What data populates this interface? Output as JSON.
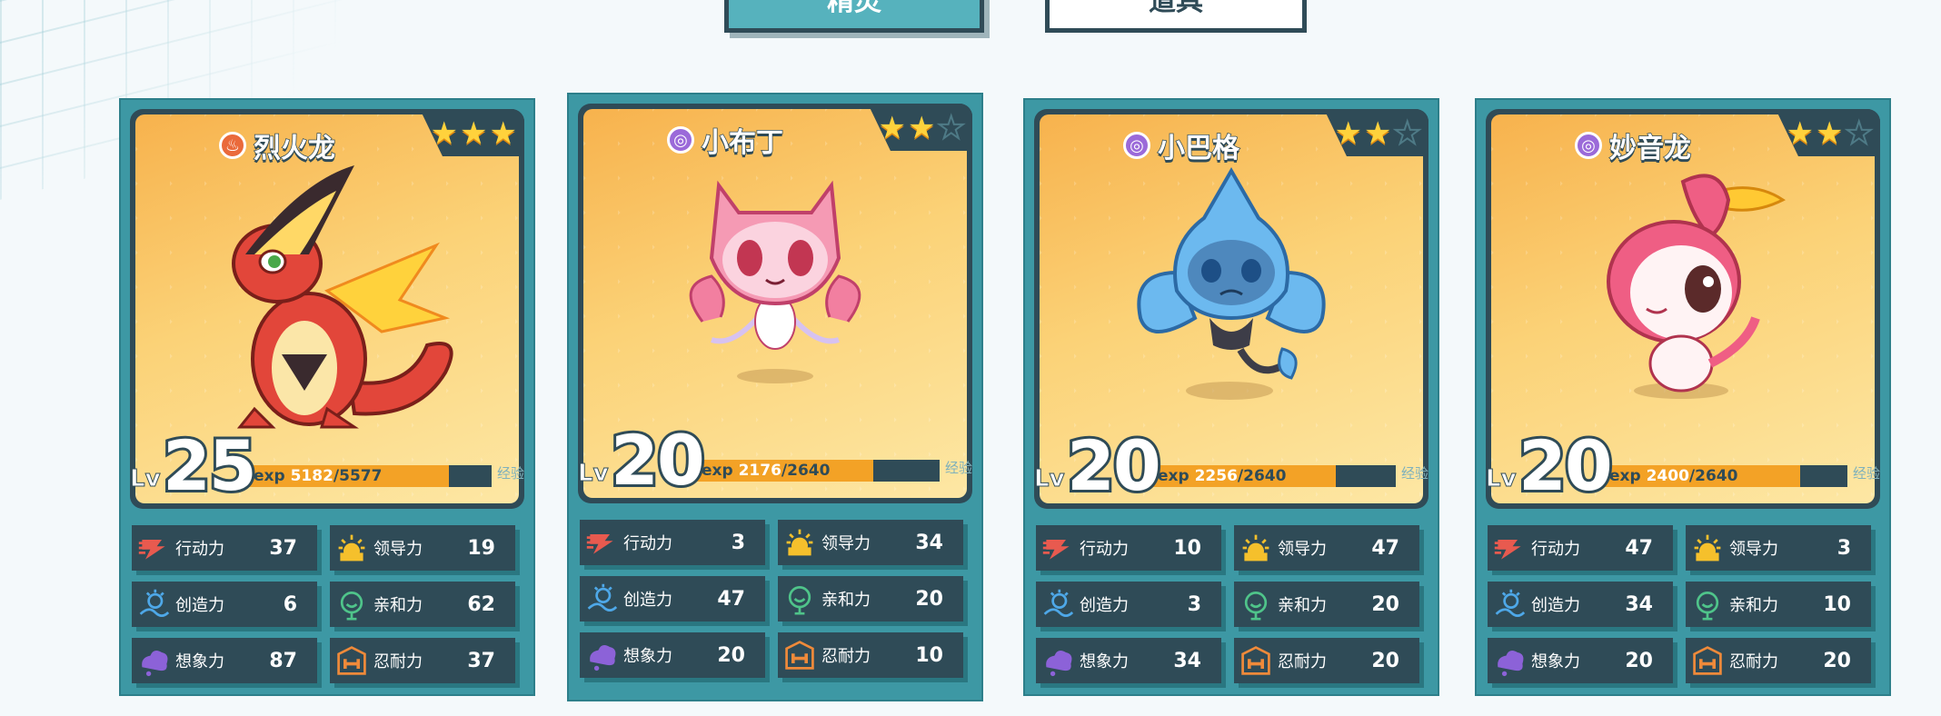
{
  "tabs": [
    {
      "label": "精灵",
      "active": true
    },
    {
      "label": "道具",
      "active": false
    }
  ],
  "cards": [
    {
      "name": "烈火龙",
      "element_icon": "fire-element-icon",
      "stars": 3,
      "max_stars": 3,
      "level": "25",
      "lv_prefix": "Lv",
      "exp_prefix": "exp",
      "exp_current": "5182",
      "exp_max": "/5577",
      "exp_fraction": 0.93,
      "exp_button": "经验",
      "stats": [
        {
          "label": "行动力",
          "value": "37",
          "icon": "action-icon",
          "color": "#e85a4f"
        },
        {
          "label": "领导力",
          "value": "19",
          "icon": "leadership-icon",
          "color": "#f5c02c"
        },
        {
          "label": "创造力",
          "value": "6",
          "icon": "creativity-icon",
          "color": "#4ea8e8"
        },
        {
          "label": "亲和力",
          "value": "62",
          "icon": "affinity-icon",
          "color": "#4fc48a"
        },
        {
          "label": "想象力",
          "value": "87",
          "icon": "imagination-icon",
          "color": "#8c62d8"
        },
        {
          "label": "忍耐力",
          "value": "37",
          "icon": "endurance-icon",
          "color": "#ef8a3a"
        }
      ]
    },
    {
      "name": "小布丁",
      "element_icon": "psychic-element-icon",
      "stars": 2,
      "max_stars": 3,
      "level": "20",
      "lv_prefix": "Lv",
      "exp_prefix": "exp",
      "exp_current": "2176",
      "exp_max": "/2640",
      "exp_fraction": 0.82,
      "exp_button": "经验",
      "stats": [
        {
          "label": "行动力",
          "value": "3",
          "icon": "action-icon",
          "color": "#e85a4f"
        },
        {
          "label": "领导力",
          "value": "34",
          "icon": "leadership-icon",
          "color": "#f5c02c"
        },
        {
          "label": "创造力",
          "value": "47",
          "icon": "creativity-icon",
          "color": "#4ea8e8"
        },
        {
          "label": "亲和力",
          "value": "20",
          "icon": "affinity-icon",
          "color": "#4fc48a"
        },
        {
          "label": "想象力",
          "value": "20",
          "icon": "imagination-icon",
          "color": "#8c62d8"
        },
        {
          "label": "忍耐力",
          "value": "10",
          "icon": "endurance-icon",
          "color": "#ef8a3a"
        }
      ]
    },
    {
      "name": "小巴格",
      "element_icon": "psychic-element-icon",
      "stars": 2,
      "max_stars": 3,
      "level": "20",
      "lv_prefix": "Lv",
      "exp_prefix": "exp",
      "exp_current": "2256",
      "exp_max": "/2640",
      "exp_fraction": 0.85,
      "exp_button": "经验",
      "stats": [
        {
          "label": "行动力",
          "value": "10",
          "icon": "action-icon",
          "color": "#e85a4f"
        },
        {
          "label": "领导力",
          "value": "47",
          "icon": "leadership-icon",
          "color": "#f5c02c"
        },
        {
          "label": "创造力",
          "value": "3",
          "icon": "creativity-icon",
          "color": "#4ea8e8"
        },
        {
          "label": "亲和力",
          "value": "20",
          "icon": "affinity-icon",
          "color": "#4fc48a"
        },
        {
          "label": "想象力",
          "value": "34",
          "icon": "imagination-icon",
          "color": "#8c62d8"
        },
        {
          "label": "忍耐力",
          "value": "20",
          "icon": "endurance-icon",
          "color": "#ef8a3a"
        }
      ]
    },
    {
      "name": "妙音龙",
      "element_icon": "psychic-element-icon",
      "stars": 2,
      "max_stars": 3,
      "level": "20",
      "lv_prefix": "Lv",
      "exp_prefix": "exp",
      "exp_current": "2400",
      "exp_max": "/2640",
      "exp_fraction": 0.91,
      "exp_button": "经验",
      "stats": [
        {
          "label": "行动力",
          "value": "47",
          "icon": "action-icon",
          "color": "#e85a4f"
        },
        {
          "label": "领导力",
          "value": "3",
          "icon": "leadership-icon",
          "color": "#f5c02c"
        },
        {
          "label": "创造力",
          "value": "34",
          "icon": "creativity-icon",
          "color": "#4ea8e8"
        },
        {
          "label": "亲和力",
          "value": "10",
          "icon": "affinity-icon",
          "color": "#4fc48a"
        },
        {
          "label": "想象力",
          "value": "20",
          "icon": "imagination-icon",
          "color": "#8c62d8"
        },
        {
          "label": "忍耐力",
          "value": "20",
          "icon": "endurance-icon",
          "color": "#ef8a3a"
        }
      ]
    }
  ]
}
